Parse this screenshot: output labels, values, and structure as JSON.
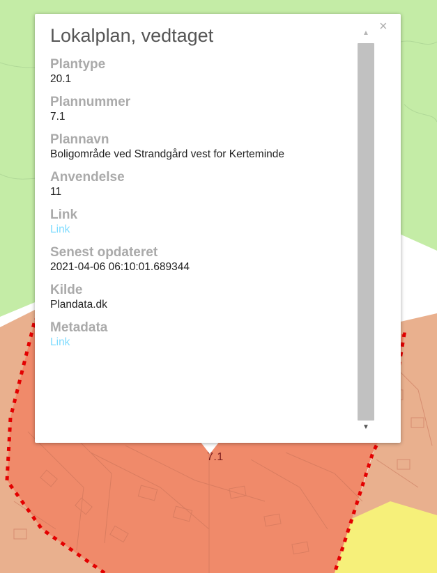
{
  "map": {
    "plan_label": "7.1",
    "colors": {
      "green_area": "#c4eca6",
      "white_road": "#ffffff",
      "orange_area": "#e9a886",
      "plan_area": "#f08a6a",
      "yellow_area": "#f6f07a",
      "boundary": "#e30000"
    }
  },
  "popup": {
    "title": "Lokalplan, vedtaget",
    "close_icon": "×",
    "scroll_up_icon": "▲",
    "scroll_down_icon": "▼",
    "fields": [
      {
        "label": "Plantype",
        "value": "20.1"
      },
      {
        "label": "Plannummer",
        "value": "7.1"
      },
      {
        "label": "Plannavn",
        "value": "Boligområde ved Strandgård vest for Kerteminde"
      },
      {
        "label": "Anvendelse",
        "value": "11"
      },
      {
        "label": "Link",
        "value": "Link"
      },
      {
        "label": "Senest opdateret",
        "value": "2021-04-06 06:10:01.689344"
      },
      {
        "label": "Kilde",
        "value": "Plandata.dk"
      },
      {
        "label": "Metadata",
        "value": "Link"
      }
    ]
  }
}
